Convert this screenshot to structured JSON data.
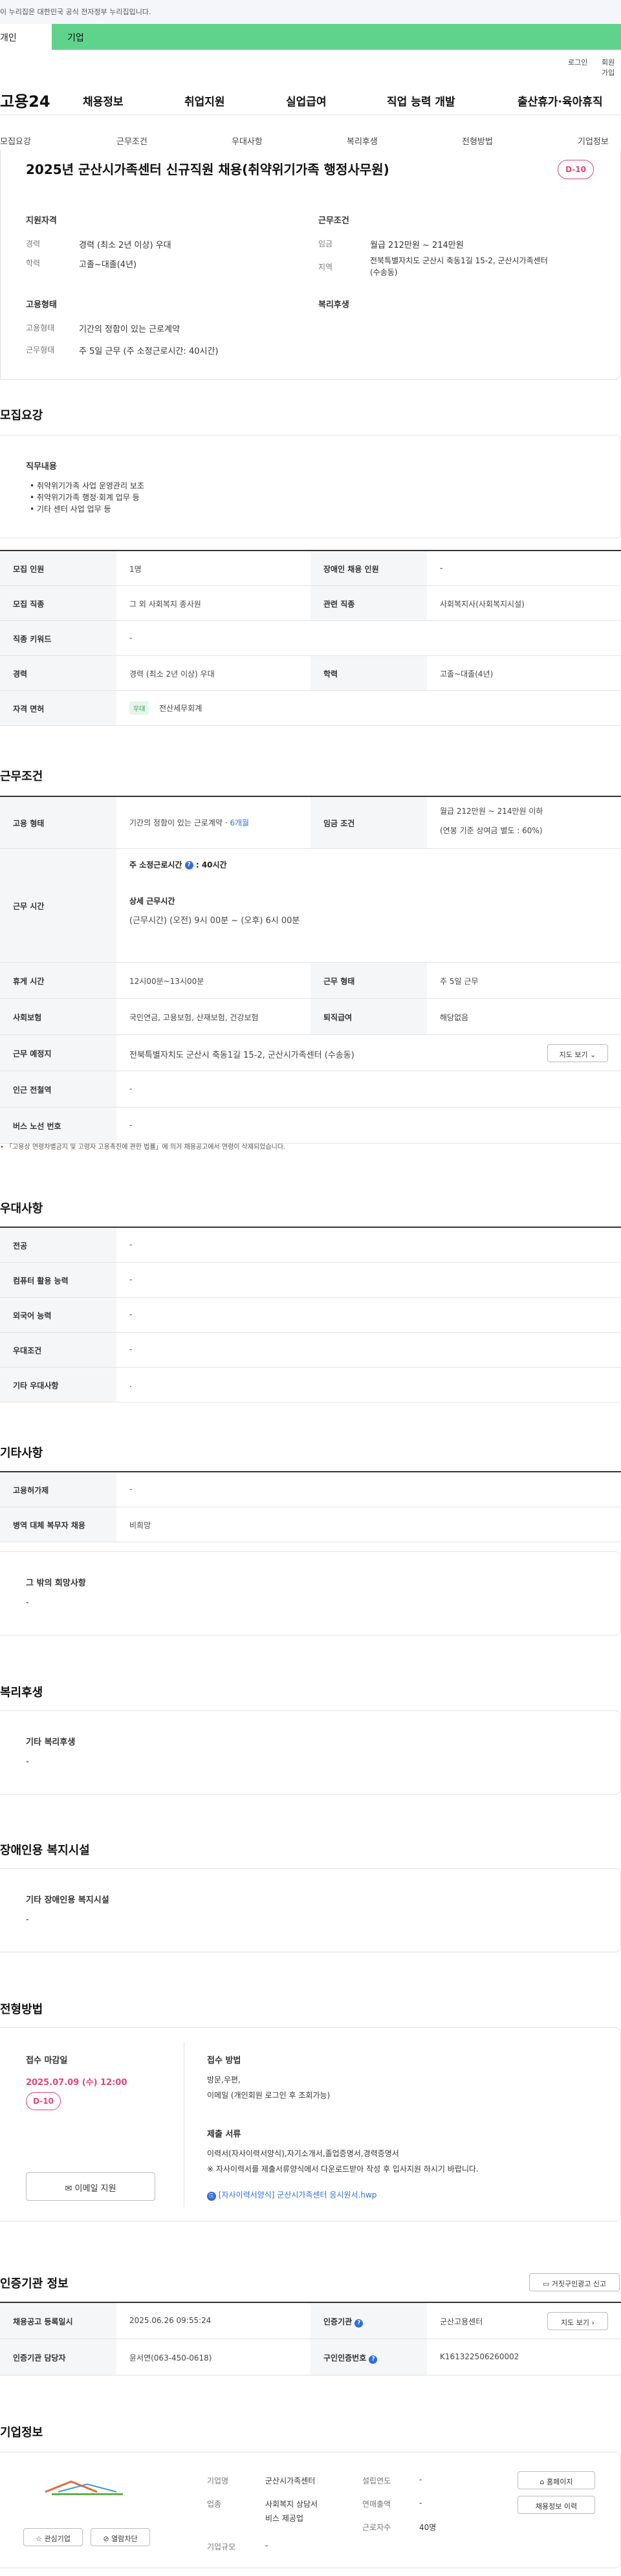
{
  "gov_banner": "이 누리집은 대한민국 공식 전자정부 누리집입니다.",
  "top_tabs": {
    "individual": "개인",
    "corporate": "기업"
  },
  "util": {
    "login": "로그인",
    "signup": "회원가입"
  },
  "logo": "고용24",
  "gnb": [
    "채용정보",
    "취업지원",
    "실업급여",
    "직업 능력 개발",
    "출산휴가·육아휴직"
  ],
  "subnav": [
    "모집요강",
    "근무조건",
    "우대사항",
    "복리후생",
    "전형방법",
    "기업정보"
  ],
  "header": {
    "title": "2025년 군산시가족센터 신규직원 채용(취약위기가족 행정사무원)",
    "dday": "D-10",
    "qual_title": "지원자격",
    "career_label": "경력",
    "career_value": "경력 (최소 2년 이상) 우대",
    "edu_label": "학력",
    "edu_value": "고졸~대졸(4년)",
    "cond_title": "근무조건",
    "wage_label": "임금",
    "wage_value": "월급 212만원 ~ 214만원",
    "region_label": "지역",
    "region_value_1": "전북특별자치도 군산시 축동1길 15-2, 군산시가족센터",
    "region_value_2": "(수송동)",
    "emp_title": "고용형태",
    "emptype_label": "고용형태",
    "emptype_value": "기간의 정함이 있는 근로계약",
    "worktype_label": "근무형태",
    "worktype_value": "주 5일 근무 (주 소정근로시간: 40시간)",
    "welfare_title": "복리후생"
  },
  "recruit": {
    "section_title": "모집요강",
    "duties_title": "직무내용",
    "duties": [
      "• 취약위기가족 사업 운영관리 보조",
      "• 취약위기가족 행정·회계 업무 등",
      "• 기타 센터 사업 업무 등"
    ],
    "rows": {
      "headcount_label": "모집 인원",
      "headcount_value": "1명",
      "disabled_label": "장애인 채용 인원",
      "disabled_value": "-",
      "job_label": "모집 직종",
      "job_value": "그 외 사회복지 종사원",
      "related_label": "관련 직종",
      "related_value": "사회복지사(사회복지시설)",
      "keyword_label": "직종 키워드",
      "keyword_value": "-",
      "career_label": "경력",
      "career_value": "경력 (최소 2년 이상) 우대",
      "edu_label": "학력",
      "edu_value": "고졸~대졸(4년)",
      "license_label": "자격 면허",
      "license_tag": "우대",
      "license_value": "전산세무회계"
    }
  },
  "conditions": {
    "section_title": "근무조건",
    "emp_label": "고용 형태",
    "emp_value": "기간의 정함이 있는 근로계약 · ",
    "emp_months": "6개월",
    "wage_label": "임금 조건",
    "wage_value_1": "월급 212만원 ~ 214만원 이하",
    "wage_value_2": "(연봉 기준 상여금 별도 : 60%)",
    "hours_label": "근무 시간",
    "hours_weekly": "주 소정근로시간",
    "hours_weekly_value": ": 40시간",
    "hours_detail_title": "상세 근무시간",
    "hours_detail": "(근무시간) (오전) 9시 00분 ~ (오후) 6시 00분",
    "break_label": "휴게 시간",
    "break_value": "12시00분~13시00분",
    "worktype_label": "근무 형태",
    "worktype_value": "주 5일 근무",
    "insurance_label": "사회보험",
    "insurance_value": "국민연금, 고용보험, 산재보험, 건강보험",
    "severance_label": "퇴직급여",
    "severance_value": "해당없음",
    "place_label": "근무 예정지",
    "place_value": "전북특별자치도 군산시 축동1길 15-2, 군산시가족센터 (수송동)",
    "map_btn": "지도 보기",
    "subway_label": "인근 전철역",
    "subway_value": "-",
    "bus_label": "버스 노선 번호",
    "bus_value": "-",
    "note": "• 「고용상 연령차별금지 및 고령자 고용촉진에 관한 법률」에 의거 채용공고에서 연령이 삭제되었습니다."
  },
  "prefer": {
    "section_title": "우대사항",
    "rows": [
      {
        "label": "전공",
        "value": "-"
      },
      {
        "label": "컴퓨터 활용 능력",
        "value": "-"
      },
      {
        "label": "외국어 능력",
        "value": "-"
      },
      {
        "label": "우대조건",
        "value": "-"
      },
      {
        "label": "기타 우대사항",
        "value": "."
      }
    ]
  },
  "etc": {
    "section_title": "기타사항",
    "rows": [
      {
        "label": "고용허가제",
        "value": "-"
      },
      {
        "label": "병역 대체 복무자 채용",
        "value": "비희망"
      }
    ],
    "wish_title": "그 밖의 희망사항",
    "wish_value": "-"
  },
  "welfare": {
    "section_title": "복리후생",
    "box_title": "기타 복리후생",
    "box_value": "-"
  },
  "disabled_fac": {
    "section_title": "장애인용 복지시설",
    "box_title": "기타 장애인용 복지시설",
    "box_value": "-"
  },
  "selection": {
    "section_title": "전형방법",
    "deadline_title": "접수 마감일",
    "deadline_value": "2025.07.09 (수) 12:00",
    "dday": "D-10",
    "email_btn": "이메일 지원",
    "method_title": "접수 방법",
    "method_value_1": "방문,우편,",
    "method_value_2": "이메일 (개인회원 로그인 후 조회가능)",
    "docs_title": "제출 서류",
    "docs_value_1": "이력서(자사이력서양식),자기소개서,졸업증명서,경력증명서",
    "docs_value_2": "※ 자사이력서를 제출서류양식에서 다운로드받아 작성 후 입사지원 하시기 바랍니다.",
    "file_link": "[자사이력서양식] 군산시가족센터 응시원서.hwp"
  },
  "cert": {
    "section_title": "인증기관 정보",
    "report_btn": "거짓구인광고 신고",
    "reg_date_label": "채용공고 등록일시",
    "reg_date_value": "2025.06.26 09:55:24",
    "agency_label": "인증기관",
    "agency_value": "군산고용센터",
    "map_btn": "지도 보기",
    "manager_label": "인증기관 담당자",
    "manager_value": "윤서연(063-450-0618)",
    "certno_label": "구인인증번호",
    "certno_value": "K161322506260002"
  },
  "company": {
    "section_title": "기업정보",
    "fav_btn": "관심기업",
    "block_btn": "열람차단",
    "name_label": "기업명",
    "name_value": "군산시가족센터",
    "industry_label": "업종",
    "industry_value_1": "사회복지 상담서",
    "industry_value_2": "비스 제공업",
    "scale_label": "기업규모",
    "scale_value": "-",
    "founded_label": "설립연도",
    "founded_value": "-",
    "sales_label": "연매출액",
    "sales_value": "-",
    "employees_label": "근로자수",
    "employees_value": "40명",
    "homepage_btn": "홈페이지",
    "history_btn": "채용정보 이력"
  },
  "colors": {
    "brand_green": "#5fd38b",
    "dday_pink": "#e0457b",
    "link_blue": "#2f6fd6"
  }
}
